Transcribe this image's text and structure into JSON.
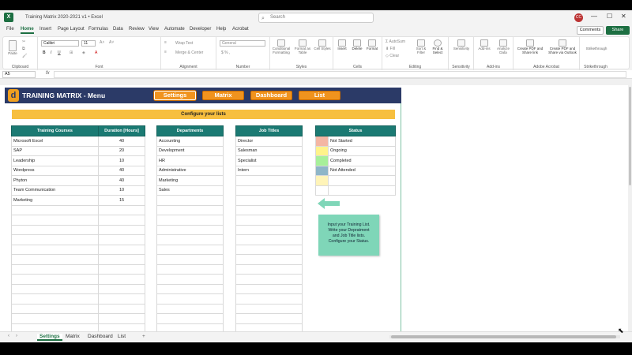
{
  "window": {
    "title": "Training Matrix 2020-2021 v1 • Excel",
    "search_placeholder": "Search",
    "avatar_initials": "CC"
  },
  "menu": {
    "items": [
      "File",
      "Home",
      "Insert",
      "Page Layout",
      "Formulas",
      "Data",
      "Review",
      "View",
      "Automate",
      "Developer",
      "Help",
      "Acrobat"
    ],
    "active": "Home",
    "comments_label": "Comments",
    "share_label": "Share"
  },
  "ribbon": {
    "groups": [
      "Clipboard",
      "Font",
      "Alignment",
      "Number",
      "Styles",
      "Cells",
      "Editing",
      "Sensitivity",
      "Add-ins",
      "Adobe Acrobat",
      "Strikethrough"
    ],
    "paste_label": "Paste",
    "font_name": "Calibri",
    "font_size": "11",
    "wrap_text": "Wrap Text",
    "merge_center": "Merge & Center",
    "number_format": "General",
    "conditional_formatting": "Conditional Formatting",
    "format_as_table": "Format as Table",
    "cell_styles": "Cell Styles",
    "insert_label": "Insert",
    "delete_label": "Delete",
    "format_label": "Format",
    "autosum": "AutoSum",
    "fill": "Fill",
    "clear": "Clear",
    "sort_filter": "Sort & Filter",
    "find_select": "Find & Select",
    "sensitivity": "Sensitivity",
    "addins": "Add-ins",
    "analyze_data": "Analyze Data",
    "create_pdf_share": "Create PDF and Share link",
    "create_pdf_outlook": "Create PDF and Share via Outlook",
    "strikethrough": "Strikethrough"
  },
  "formula_bar": {
    "name_box": "A5",
    "fx": "fx",
    "value": ""
  },
  "banner": {
    "logo_letter": "d",
    "title": "TRAINING MATRIX - Menu",
    "nav": [
      "Settings",
      "Matrix",
      "Dashboard",
      "List"
    ],
    "selected": "Settings"
  },
  "config_title": "Configure your lists",
  "courses": {
    "headers": [
      "Training Courses",
      "Duration [Hours]"
    ],
    "rows": [
      [
        "Microsoft Excel",
        "40"
      ],
      [
        "SAP",
        "20"
      ],
      [
        "Leadership",
        "10"
      ],
      [
        "Wordpress",
        "40"
      ],
      [
        "Phyton",
        "40"
      ],
      [
        "Team Communication",
        "10"
      ],
      [
        "Marketing",
        "15"
      ]
    ]
  },
  "departments": {
    "header": "Departments",
    "rows": [
      "Accounting",
      "Development",
      "HR",
      "Administrative",
      "Marketing",
      "Sales"
    ]
  },
  "job_titles": {
    "header": "Job Titles",
    "rows": [
      "Director",
      "Salesman",
      "Specialist",
      "Intern"
    ]
  },
  "status": {
    "header": "Status",
    "rows": [
      {
        "label": "Not Started",
        "color": "#f4b6a3"
      },
      {
        "label": "Ongoing",
        "color": "#fff38a"
      },
      {
        "label": "Completed",
        "color": "#a7f09a"
      },
      {
        "label": "Not Attended",
        "color": "#8fb6c8"
      },
      {
        "label": "",
        "color": "#fff4b8"
      }
    ]
  },
  "note": {
    "lines": [
      "Input your Training List.",
      "Write your Depratment",
      "and Job Title lists.",
      "Configure your Status."
    ]
  },
  "sheet_tabs": {
    "tabs": [
      "Settings",
      "Matrix",
      "Dashboard",
      "List"
    ],
    "active": "Settings",
    "add": "+"
  },
  "colors": {
    "banner": "#2b3a67",
    "nav_button": "#f0931e",
    "table_header": "#1b7a73",
    "config_bar": "#f7bf3f",
    "note": "#7fd6b8",
    "excel_green": "#1d6f42"
  }
}
